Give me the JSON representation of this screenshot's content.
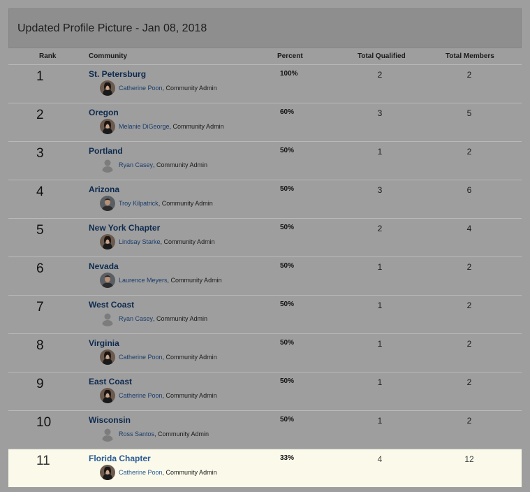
{
  "header": {
    "title": "Updated Profile Picture - Jan 08, 2018"
  },
  "columns": {
    "rank": "Rank",
    "community": "Community",
    "percent": "Percent",
    "qualified": "Total Qualified",
    "members": "Total Members"
  },
  "rows": [
    {
      "rank": "1",
      "community": "St. Petersburg",
      "admin": "Catherine Poon",
      "role": ", Community Admin",
      "avatar": "female-avatar-icon",
      "percent": "100%",
      "qualified": "2",
      "members": "2"
    },
    {
      "rank": "2",
      "community": "Oregon",
      "admin": "Melanie DiGeorge",
      "role": ", Community Admin",
      "avatar": "female-avatar-icon",
      "percent": "60%",
      "qualified": "3",
      "members": "5"
    },
    {
      "rank": "3",
      "community": "Portland",
      "admin": "Ryan Casey",
      "role": ", Community Admin",
      "avatar": "default-avatar-icon",
      "percent": "50%",
      "qualified": "1",
      "members": "2"
    },
    {
      "rank": "4",
      "community": "Arizona",
      "admin": "Troy Kilpatrick",
      "role": ", Community Admin",
      "avatar": "male-avatar-icon",
      "percent": "50%",
      "qualified": "3",
      "members": "6"
    },
    {
      "rank": "5",
      "community": "New York Chapter",
      "admin": "Lindsay Starke",
      "role": ", Community Admin",
      "avatar": "female-avatar-icon",
      "percent": "50%",
      "qualified": "2",
      "members": "4"
    },
    {
      "rank": "6",
      "community": "Nevada",
      "admin": "Laurence Meyers",
      "role": ", Community Admin",
      "avatar": "male-avatar-icon",
      "percent": "50%",
      "qualified": "1",
      "members": "2"
    },
    {
      "rank": "7",
      "community": "West Coast",
      "admin": "Ryan Casey",
      "role": ", Community Admin",
      "avatar": "default-avatar-icon",
      "percent": "50%",
      "qualified": "1",
      "members": "2"
    },
    {
      "rank": "8",
      "community": "Virginia",
      "admin": "Catherine Poon",
      "role": ", Community Admin",
      "avatar": "female-avatar-icon",
      "percent": "50%",
      "qualified": "1",
      "members": "2"
    },
    {
      "rank": "9",
      "community": "East Coast",
      "admin": "Catherine Poon",
      "role": ", Community Admin",
      "avatar": "female-avatar-icon",
      "percent": "50%",
      "qualified": "1",
      "members": "2"
    },
    {
      "rank": "10",
      "community": "Wisconsin",
      "admin": "Ross Santos",
      "role": ", Community Admin",
      "avatar": "default-avatar-icon",
      "percent": "50%",
      "qualified": "1",
      "members": "2"
    },
    {
      "rank": "11",
      "community": "Florida Chapter",
      "admin": "Catherine Poon",
      "role": ", Community Admin",
      "avatar": "female-avatar-icon",
      "percent": "33%",
      "qualified": "4",
      "members": "12",
      "highlighted": true
    }
  ]
}
